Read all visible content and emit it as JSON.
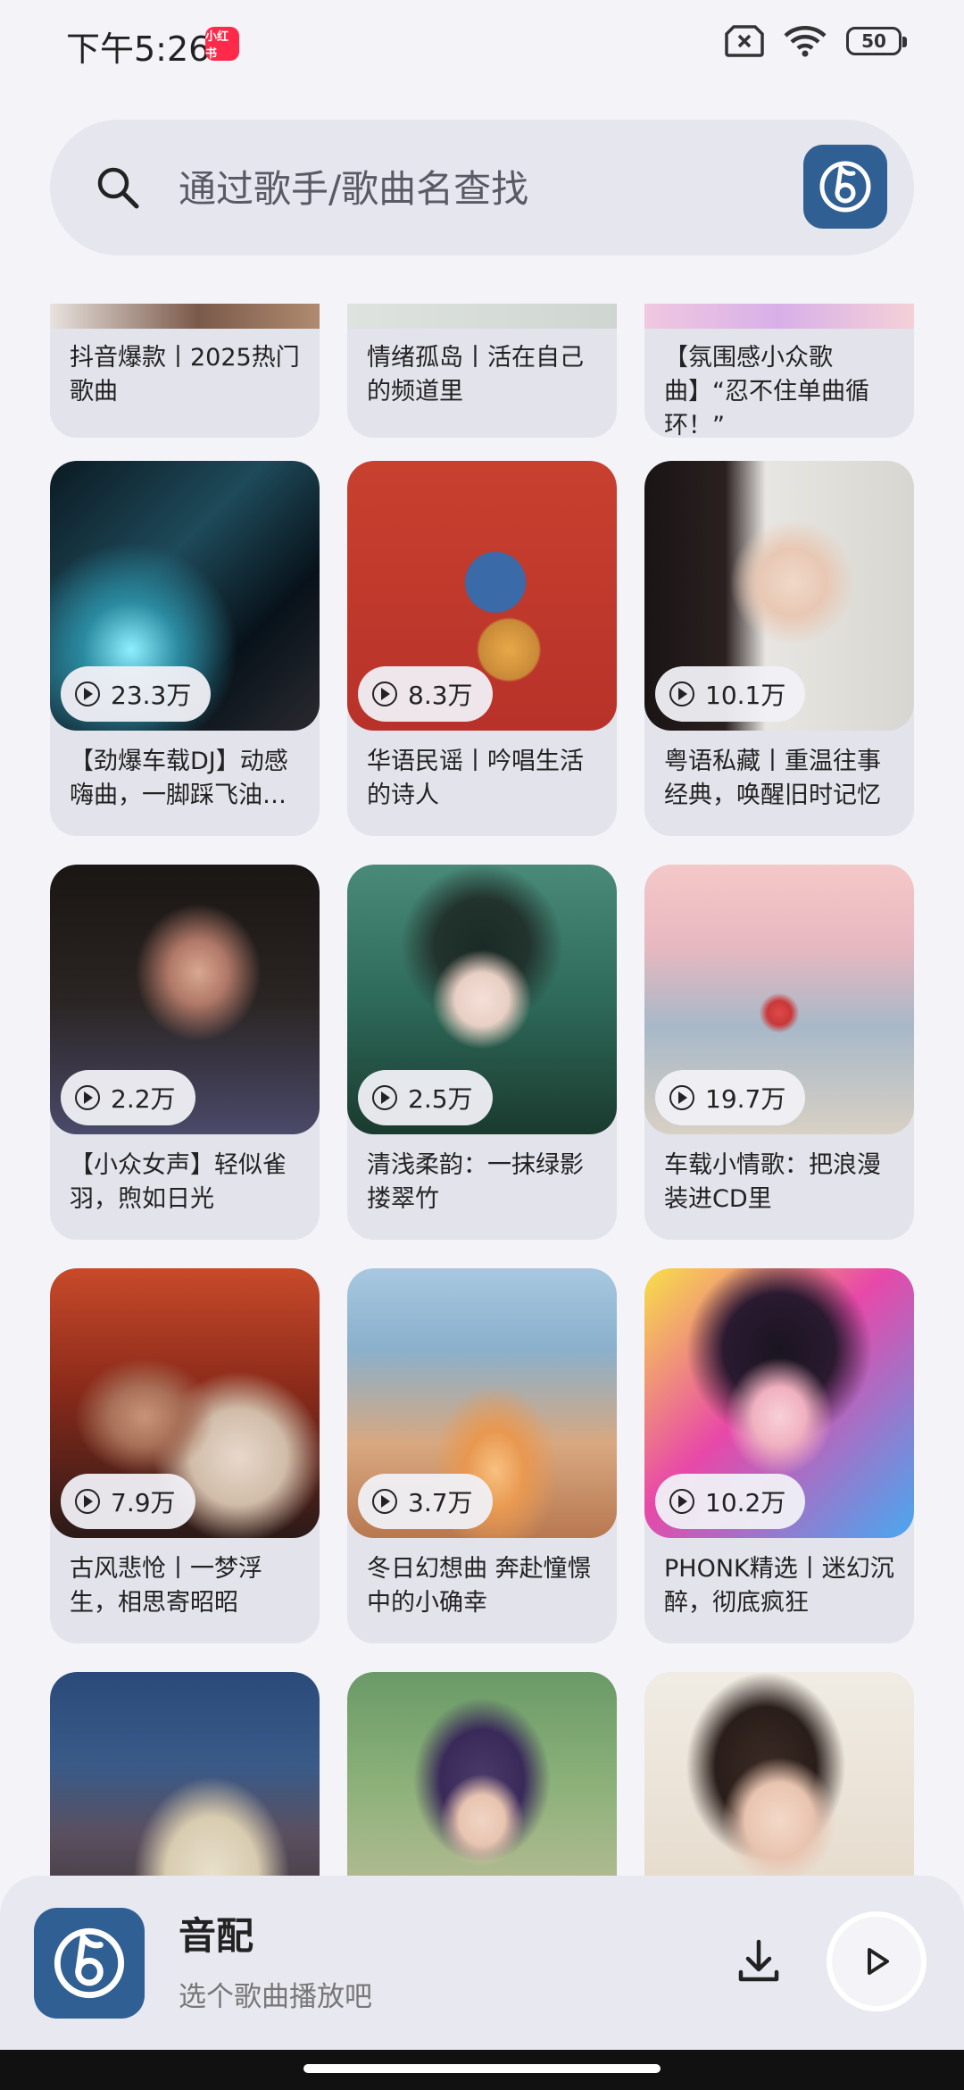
{
  "status": {
    "time": "下午5:26",
    "app_badge": "小红书",
    "battery": "50"
  },
  "search": {
    "placeholder": "通过歌手/歌曲名查找"
  },
  "top_cards": [
    {
      "title": "抖音爆款丨2025热门歌曲"
    },
    {
      "title": "情绪孤岛丨活在自己的频道里"
    },
    {
      "title": "【氛围感小众歌曲】“忍不住单曲循环！”"
    }
  ],
  "cards": [
    {
      "count": "23.3万",
      "title": "【劲爆车载DJ】动感嗨曲，一脚踩飞油…"
    },
    {
      "count": "8.3万",
      "title": "华语民谣丨吟唱生活的诗人"
    },
    {
      "count": "10.1万",
      "title": "粤语私藏丨重温往事经典，唤醒旧时记忆"
    },
    {
      "count": "2.2万",
      "title": "【小众女声】轻似雀羽，煦如日光"
    },
    {
      "count": "2.5万",
      "title": "清浅柔韵：一抹绿影搂翠竹"
    },
    {
      "count": "19.7万",
      "title": "车载小情歌：把浪漫装进CD里"
    },
    {
      "count": "7.9万",
      "title": "古风悲怆丨一梦浮生，相思寄昭昭"
    },
    {
      "count": "3.7万",
      "title": "冬日幻想曲 奔赴憧憬中的小确幸"
    },
    {
      "count": "10.2万",
      "title": "PHONK精选丨迷幻沉醉，彻底疯狂"
    }
  ],
  "player": {
    "title": "音配",
    "subtitle": "选个歌曲播放吧"
  },
  "colors": {
    "brand": "#2f5f93",
    "background": "#f3f3f8",
    "card": "#e3e3ec"
  },
  "icons": {
    "search": "search-icon",
    "download": "download-icon",
    "play": "play-icon",
    "logo": "music-note-logo-icon"
  }
}
